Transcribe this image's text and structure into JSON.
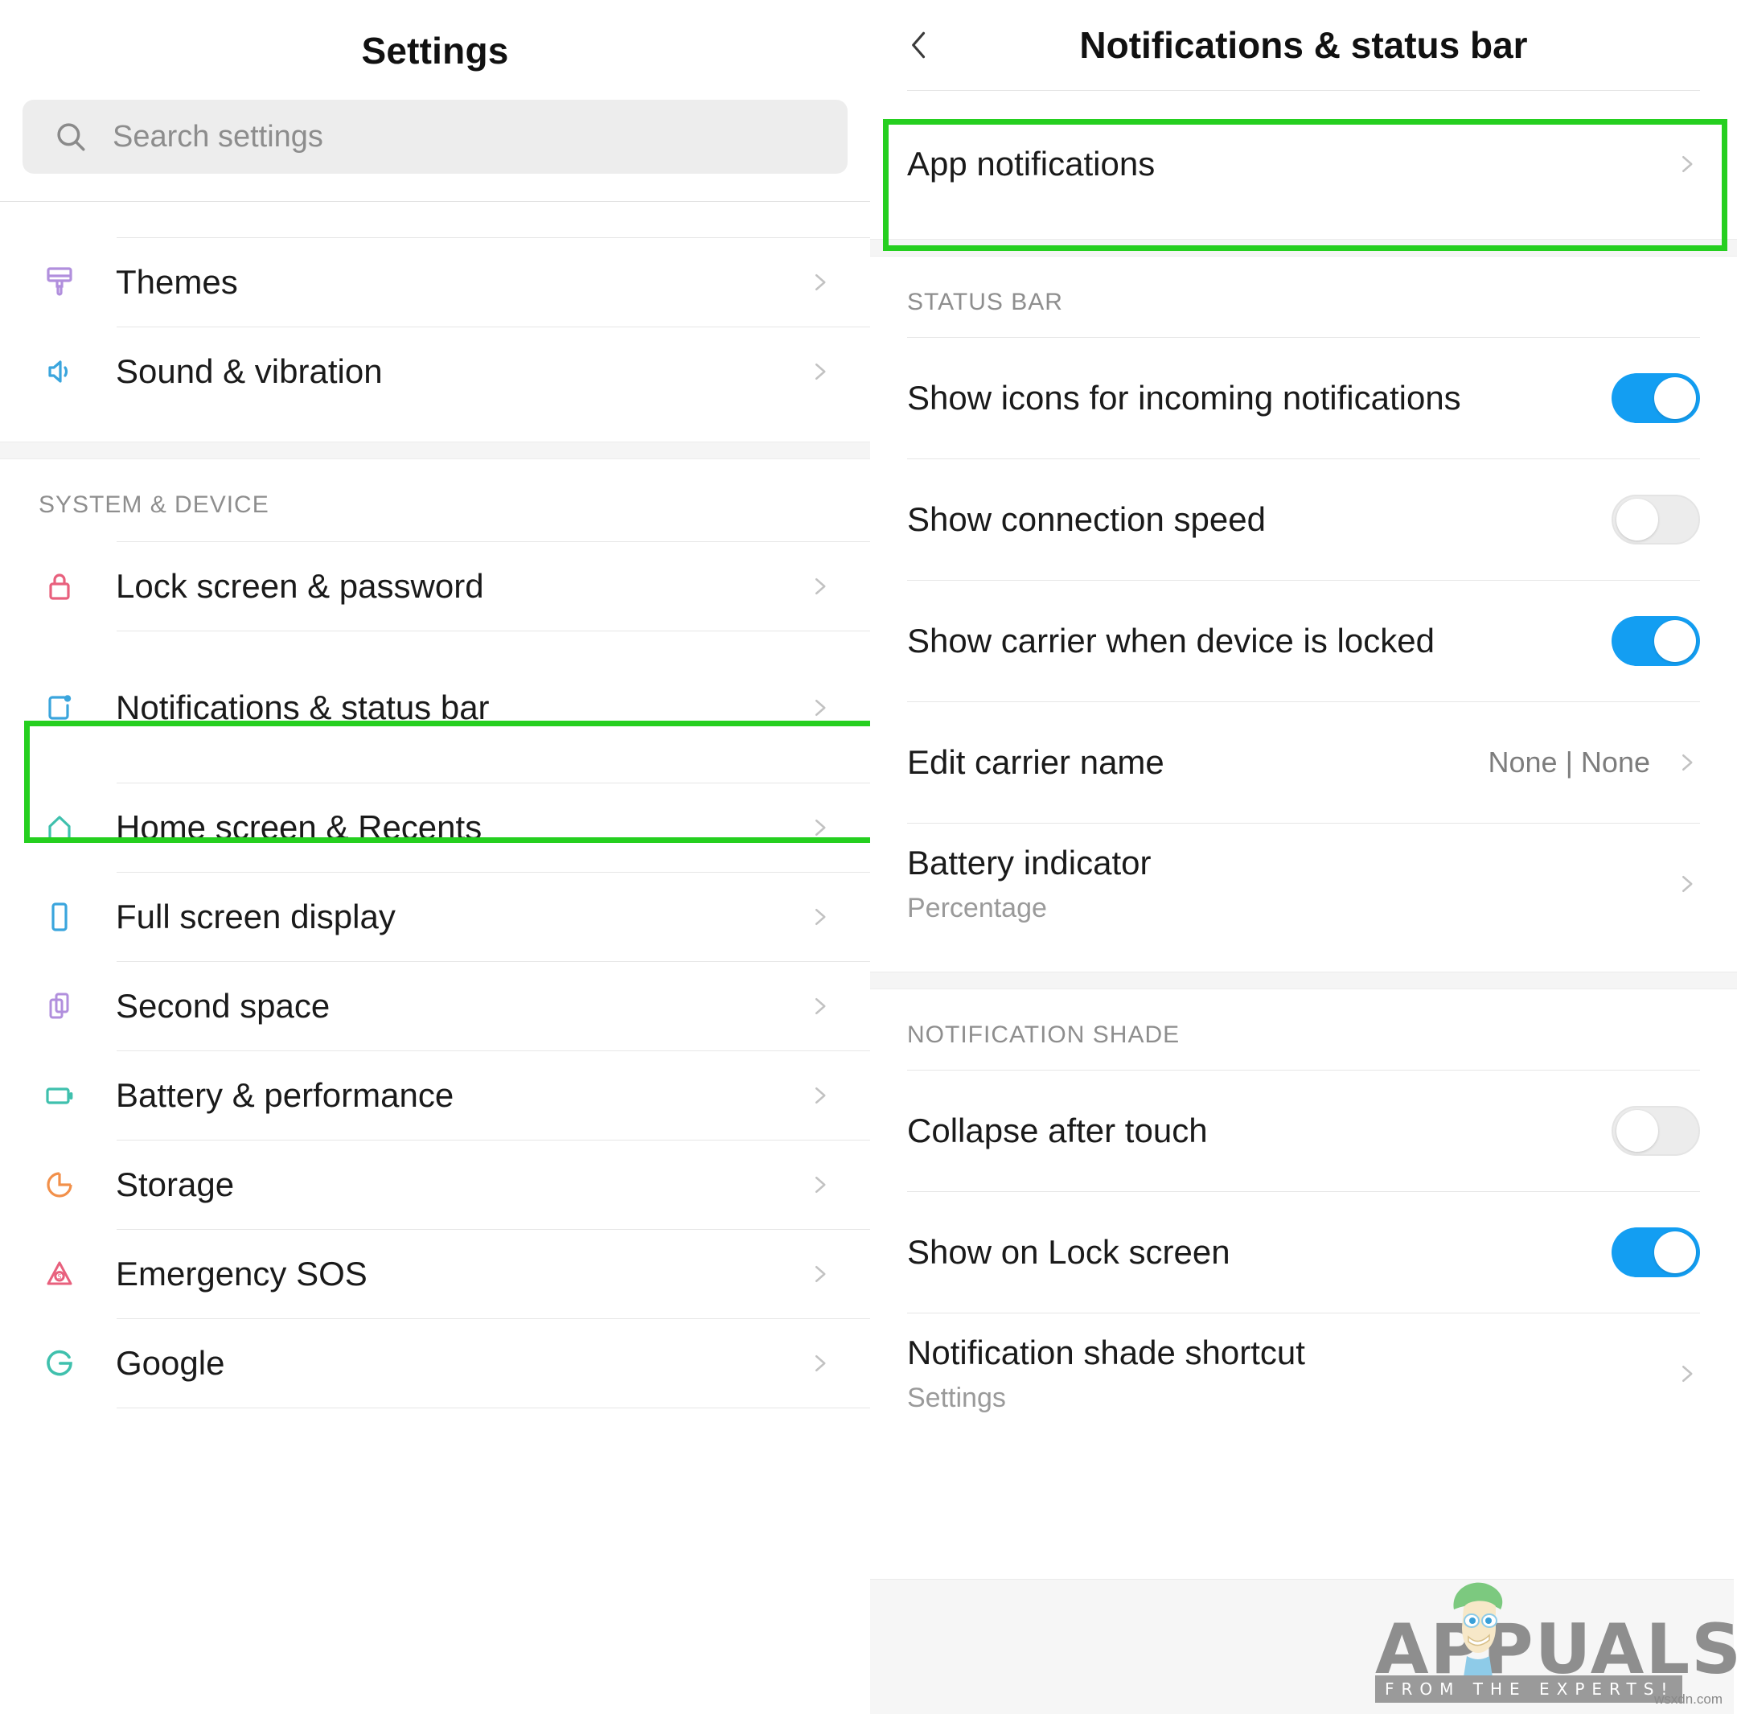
{
  "left": {
    "title": "Settings",
    "search": {
      "placeholder": "Search settings",
      "icon": "search-icon"
    },
    "sections": [
      {
        "label": "",
        "items": [
          {
            "label": "Themes",
            "icon": "brush-icon",
            "color": "#b18fdd"
          },
          {
            "label": "Sound & vibration",
            "icon": "speaker-icon",
            "color": "#3aa5dd"
          }
        ]
      },
      {
        "label": "SYSTEM & DEVICE",
        "items": [
          {
            "label": "Lock screen & password",
            "icon": "lock-icon",
            "color": "#e8607d"
          },
          {
            "label": "Notifications & status bar",
            "icon": "notification-badge-icon",
            "color": "#3aa5dd",
            "highlighted": true
          },
          {
            "label": "Home screen & Recents",
            "icon": "home-icon",
            "color": "#3fc0ad"
          },
          {
            "label": "Full screen display",
            "icon": "phone-icon",
            "color": "#3aa5dd"
          },
          {
            "label": "Second space",
            "icon": "two-phones-icon",
            "color": "#b18fdd"
          },
          {
            "label": "Battery & performance",
            "icon": "battery-icon",
            "color": "#3fc0ad"
          },
          {
            "label": "Storage",
            "icon": "pie-chart-icon",
            "color": "#f2904a"
          },
          {
            "label": "Emergency SOS",
            "icon": "sos-triangle-icon",
            "color": "#e8607d"
          },
          {
            "label": "Google",
            "icon": "google-g-icon",
            "color": "#3fc0ad"
          }
        ]
      }
    ]
  },
  "right": {
    "title": "Notifications & status bar",
    "back_icon": "chevron-left-icon",
    "top_item": {
      "label": "App notifications",
      "type": "link",
      "highlighted": true
    },
    "sections": [
      {
        "label": "STATUS BAR",
        "items": [
          {
            "label": "Show icons for incoming notifications",
            "type": "toggle",
            "value": "on"
          },
          {
            "label": "Show connection speed",
            "type": "toggle",
            "value": "off"
          },
          {
            "label": "Show carrier when device is locked",
            "type": "toggle",
            "value": "on"
          },
          {
            "label": "Edit carrier name",
            "type": "value",
            "value": "None | None"
          },
          {
            "label": "Battery indicator",
            "type": "link",
            "subtitle": "Percentage"
          }
        ]
      },
      {
        "label": "NOTIFICATION SHADE",
        "items": [
          {
            "label": "Collapse after touch",
            "type": "toggle",
            "value": "off"
          },
          {
            "label": "Show on Lock screen",
            "type": "toggle",
            "value": "on"
          },
          {
            "label": "Notification shade shortcut",
            "type": "link",
            "subtitle": "Settings"
          }
        ]
      }
    ]
  },
  "watermark": {
    "brand": "APPUALS",
    "tagline": "FROM THE EXPERTS!",
    "url": "wsxdn.com"
  },
  "colors": {
    "highlight_green": "#25cf1f",
    "toggle_on": "#139ef2",
    "toggle_off": "#ececec",
    "text_primary": "#1a1a1a",
    "text_secondary": "#8e8e8e"
  }
}
